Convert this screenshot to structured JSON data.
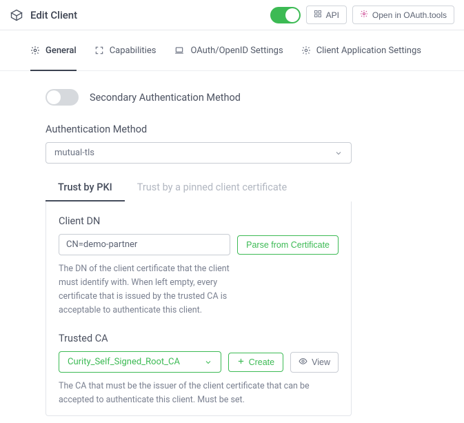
{
  "header": {
    "title": "Edit Client",
    "toggle_on": true,
    "api_button": "API",
    "oauth_tools_button": "Open in OAuth.tools"
  },
  "tabs": [
    {
      "label": "General"
    },
    {
      "label": "Capabilities"
    },
    {
      "label": "OAuth/OpenID Settings"
    },
    {
      "label": "Client Application Settings"
    }
  ],
  "secondary_auth": {
    "label": "Secondary Authentication Method",
    "toggle_on": false
  },
  "auth_method": {
    "label": "Authentication Method",
    "value": "mutual-tls"
  },
  "subtabs": {
    "pki": "Trust by PKI",
    "pinned": "Trust by a pinned client certificate"
  },
  "client_dn": {
    "label": "Client DN",
    "value": "CN=demo-partner",
    "parse_button": "Parse from Certificate",
    "help": "The DN of the client certificate that the client must identify with. When left empty, every certificate that is issued by the trusted CA is acceptable to authenticate this client."
  },
  "trusted_ca": {
    "label": "Trusted CA",
    "value": "Curity_Self_Signed_Root_CA",
    "create_button": "Create",
    "view_button": "View",
    "help": "The CA that must be the issuer of the client certificate that can be accepted to authenticate this client. Must be set."
  }
}
